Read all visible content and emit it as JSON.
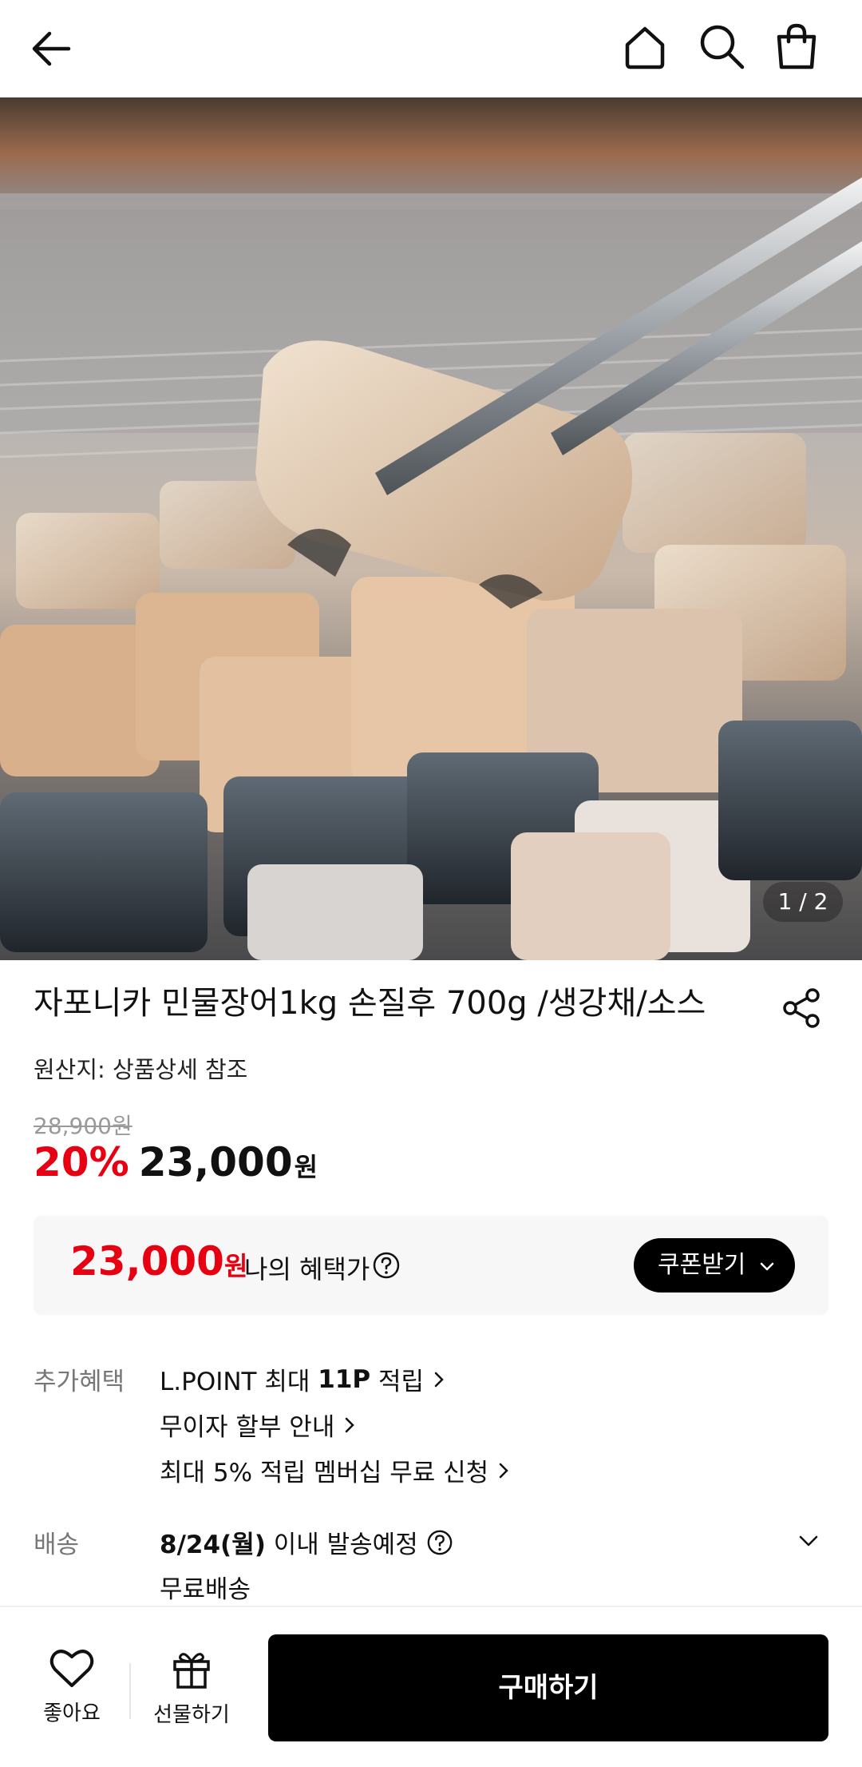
{
  "product": {
    "title": "자포니카 민물장어1kg 손질후 700g /생강채/소스",
    "origin": "원산지: 상품상세 참조",
    "original_price": "28,900원",
    "discount": "20%",
    "price": "23,000",
    "currency": "원",
    "image_pager": "1 / 2"
  },
  "benefit_box": {
    "price": "23,000",
    "currency": "원",
    "label": "나의 혜택가",
    "coupon_button": "쿠폰받기"
  },
  "extra_benefits": {
    "label": "추가혜택",
    "lpoint_prefix": "L.POINT 최대 ",
    "lpoint_bold": "11P",
    "lpoint_suffix": " 적립",
    "installment": "무이자 할부 안내",
    "membership": "최대 5% 적립 멤버십 무료 신청"
  },
  "shipping": {
    "label": "배송",
    "date_bold": "8/24(월)",
    "date_suffix": " 이내 발송예정",
    "fee": "무료배송"
  },
  "bottom_bar": {
    "like_label": "좋아요",
    "gift_label": "선물하기",
    "buy_label": "구매하기"
  },
  "colors": {
    "accent_red": "#e60012",
    "button_black": "#000000"
  },
  "icons": [
    "back-arrow-icon",
    "home-icon",
    "search-icon",
    "shopping-bag-icon",
    "share-icon",
    "question-icon",
    "chevron-down-icon",
    "chevron-right-icon",
    "heart-icon",
    "gift-icon"
  ]
}
